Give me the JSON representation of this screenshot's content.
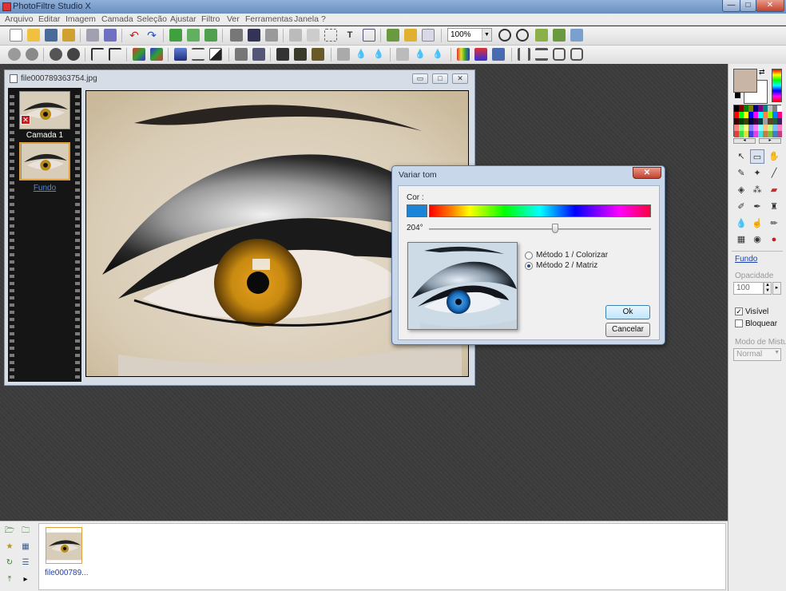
{
  "app": {
    "title": "PhotoFiltre Studio X"
  },
  "window_controls": {
    "minimize": "—",
    "maximize": "□",
    "close": "✕"
  },
  "menu": [
    "Arquivo",
    "Editar",
    "Imagem",
    "Camada",
    "Seleção",
    "Ajustar",
    "Filtro",
    "Ver",
    "Ferramentas",
    "Janela",
    "?"
  ],
  "toolbar": {
    "zoom_value": "100%"
  },
  "image_window": {
    "title": "file000789363754.jpg",
    "layers": [
      {
        "label": "Camada 1"
      },
      {
        "label": "Fundo"
      }
    ]
  },
  "dialog": {
    "title": "Variar tom",
    "color_label": "Cor :",
    "swatch_color": "#1a84d8",
    "degrees": "204°",
    "hue_value_deg": 204,
    "method1": "Método 1 / Colorizar",
    "method2": "Método 2 / Matriz",
    "selected_method": 2,
    "ok": "Ok",
    "cancel": "Cancelar"
  },
  "right_panel": {
    "foreground_color": "#c9b5a6",
    "background_color": "#ffffff",
    "layer_name": "Fundo",
    "opacity_label": "Opacidade",
    "opacity_value": "100",
    "visible_label": "Visível",
    "visible_checked": true,
    "lock_label": "Bloquear",
    "lock_checked": false,
    "blend_label": "Modo de Mistur",
    "blend_value": "Normal"
  },
  "bottom_panel": {
    "file_label": "file000789..."
  }
}
